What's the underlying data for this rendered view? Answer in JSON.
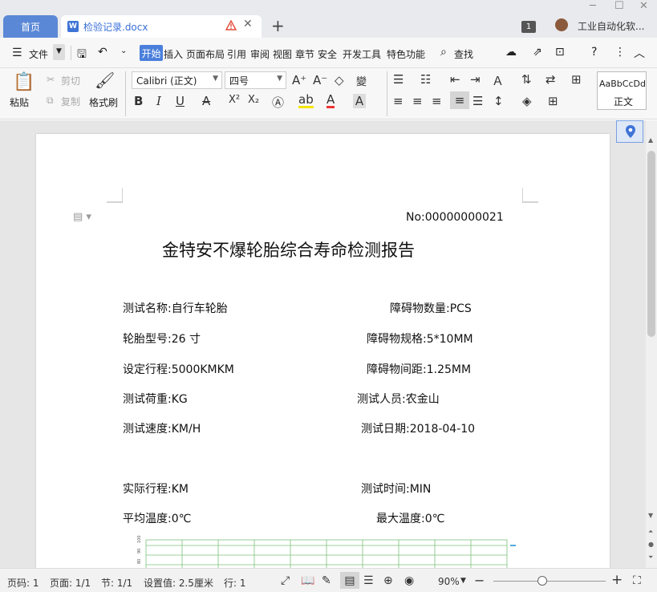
{
  "tabs": {
    "home": "首页",
    "doc": "检验记录.docx",
    "user": "工业自动化软...",
    "badge": "1"
  },
  "menu": {
    "file": "文件",
    "items": [
      "开始",
      "插入",
      "页面布局",
      "引用",
      "审阅",
      "视图",
      "章节",
      "安全",
      "开发工具",
      "特色功能"
    ],
    "search": "查找"
  },
  "ribbon": {
    "paste": "粘贴",
    "cut": "剪切",
    "copy": "复制",
    "format_painter": "格式刷",
    "font": "Calibri (正文)",
    "size": "四号",
    "style_preview": "AaBbCcDd",
    "style_name": "正文"
  },
  "doc": {
    "number": "No:00000000021",
    "title": "金特安不爆轮胎综合寿命检测报告",
    "left": [
      "测试名称:自行车轮胎",
      "轮胎型号:26 寸",
      "设定行程:5000KMKM",
      "测试荷重:KG",
      "测试速度:KM/H"
    ],
    "right": [
      "障碍物数量:PCS",
      "障碍物规格:5*10MM",
      "障碍物间距:1.25MM",
      "测试人员:农金山",
      "测试日期:2018-04-10"
    ],
    "left2": [
      "实际行程:KM",
      "平均温度:0℃"
    ],
    "right2": [
      "测试时间:MIN",
      "最大温度:0℃"
    ],
    "chart_ticks": [
      "100",
      "90",
      "80"
    ]
  },
  "status": {
    "page_no": "页码: 1",
    "pages": "页面: 1/1",
    "section": "节: 1/1",
    "setting": "设置值: 2.5厘米",
    "row": "行: 1",
    "zoom": "90%"
  }
}
